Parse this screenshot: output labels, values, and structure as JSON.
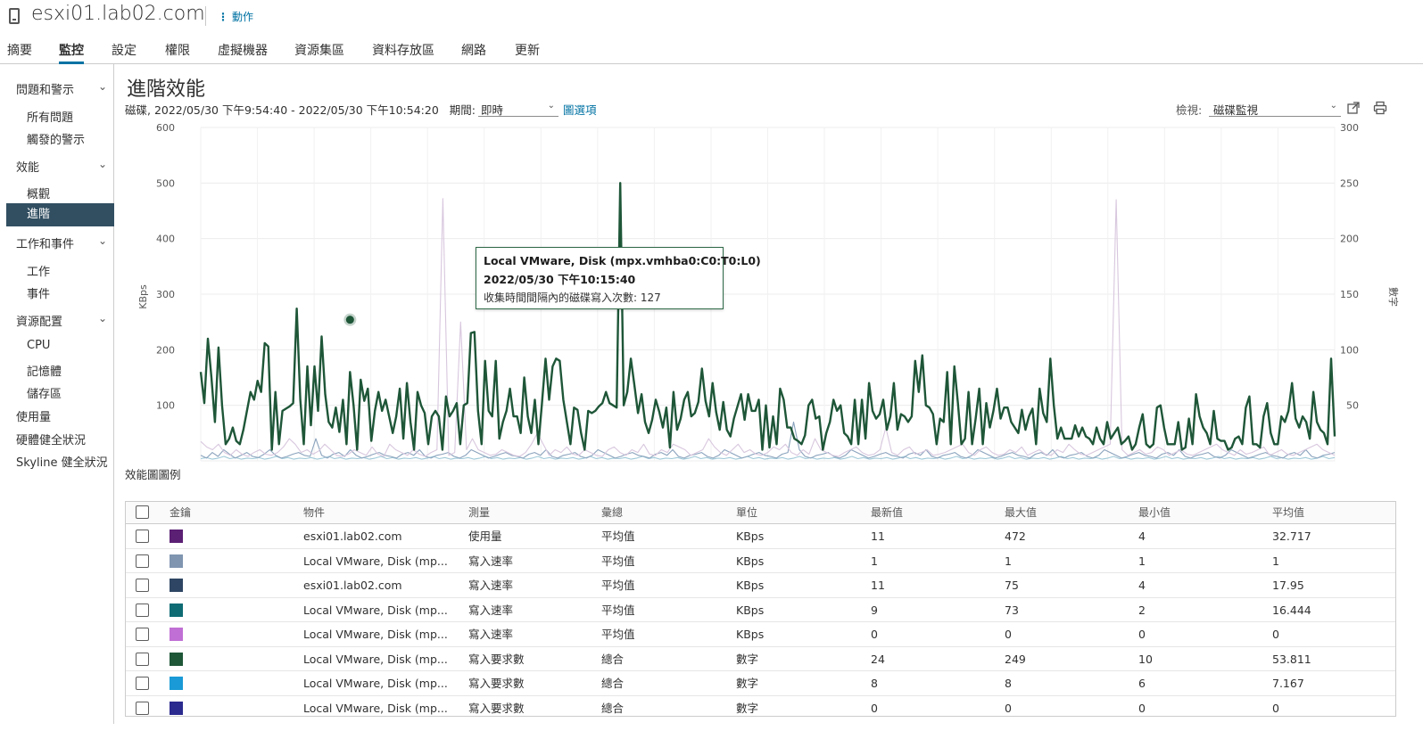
{
  "header": {
    "title": "esxi01.lab02.com",
    "actions_label": "動作"
  },
  "tabs": [
    {
      "label": "摘要"
    },
    {
      "label": "監控"
    },
    {
      "label": "設定"
    },
    {
      "label": "權限"
    },
    {
      "label": "虛擬機器"
    },
    {
      "label": "資源集區"
    },
    {
      "label": "資料存放區"
    },
    {
      "label": "網路"
    },
    {
      "label": "更新"
    }
  ],
  "active_tab": "監控",
  "sidebar": {
    "groups": [
      {
        "label": "問題和警示",
        "items": [
          "所有問題",
          "觸發的警示"
        ]
      },
      {
        "label": "效能",
        "items": [
          "概觀",
          "進階"
        ]
      },
      {
        "label": "工作和事件",
        "items": [
          "工作",
          "事件"
        ]
      },
      {
        "label": "資源配置",
        "items": [
          "CPU",
          "記憶體",
          "儲存區"
        ]
      }
    ],
    "top_items": [
      "使用量",
      "硬體健全狀況",
      "Skyline 健全狀況"
    ],
    "active_item": "進階"
  },
  "main": {
    "title": "進階效能",
    "subtitle": "磁碟, 2022/05/30 下午9:54:40 - 2022/05/30 下午10:54:20",
    "period_label": "期間:",
    "period_value": "即時",
    "chart_options_label": "圖選項",
    "view_label": "檢視:",
    "view_value": "磁碟監視",
    "legend_title": "效能圖圖例"
  },
  "tooltip": {
    "line1": "Local VMware, Disk (mpx.vmhba0:C0:T0:L0)",
    "line2": "2022/05/30 下午10:15:40",
    "line3": "收集時間間隔內的磁碟寫入次數: 127"
  },
  "chart_data": {
    "type": "line",
    "y_left": {
      "label": "KBps",
      "min": 0,
      "max": 600,
      "ticks": [
        "600",
        "500",
        "400",
        "300",
        "200",
        "100"
      ]
    },
    "y_right": {
      "label": "數字",
      "min": 0,
      "max": 300,
      "ticks": [
        "300",
        "250",
        "200",
        "150",
        "100",
        "50"
      ]
    },
    "grid": true,
    "highlight": {
      "series": "寫入要求數",
      "index": 42,
      "value": 127
    },
    "series": [
      {
        "name": "寫入要求數",
        "color": "#1e5638",
        "axis": "right",
        "width": 2.4,
        "values": [
          80,
          52,
          110,
          75,
          35,
          102,
          50,
          15,
          20,
          30,
          18,
          15,
          28,
          45,
          62,
          55,
          72,
          62,
          106,
          103,
          10,
          62,
          15,
          45,
          47,
          49,
          52,
          137,
          55,
          15,
          85,
          32,
          85,
          45,
          112,
          60,
          35,
          30,
          48,
          26,
          55,
          15,
          80,
          50,
          10,
          73,
          54,
          65,
          18,
          45,
          62,
          45,
          55,
          40,
          25,
          40,
          65,
          20,
          70,
          35,
          10,
          62,
          50,
          43,
          15,
          40,
          45,
          40,
          10,
          58,
          40,
          45,
          52,
          15,
          50,
          52,
          115,
          116,
          45,
          15,
          90,
          45,
          40,
          90,
          20,
          35,
          45,
          65,
          40,
          40,
          25,
          75,
          40,
          25,
          55,
          15,
          52,
          92,
          55,
          85,
          92,
          90,
          55,
          35,
          15,
          48,
          46,
          25,
          10,
          45,
          43,
          45,
          49,
          52,
          62,
          52,
          50,
          48,
          250,
          50,
          62,
          92,
          68,
          43,
          60,
          35,
          25,
          37,
          55,
          44,
          30,
          48,
          12,
          62,
          28,
          38,
          55,
          62,
          40,
          43,
          53,
          83,
          54,
          40,
          70,
          44,
          28,
          53,
          28,
          22,
          38,
          49,
          60,
          37,
          60,
          45,
          45,
          55,
          10,
          50,
          12,
          40,
          15,
          65,
          55,
          30,
          30,
          20,
          18,
          15,
          23,
          50,
          55,
          38,
          40,
          10,
          25,
          35,
          55,
          45,
          50,
          25,
          22,
          15,
          55,
          15,
          55,
          20,
          70,
          45,
          38,
          42,
          55,
          28,
          40,
          70,
          28,
          42,
          40,
          35,
          40,
          90,
          62,
          95,
          50,
          48,
          42,
          15,
          38,
          35,
          80,
          15,
          85,
          52,
          15,
          20,
          62,
          15,
          38,
          65,
          15,
          52,
          30,
          45,
          65,
          38,
          48,
          48,
          35,
          30,
          25,
          46,
          28,
          40,
          47,
          15,
          65,
          43,
          35,
          92,
          50,
          20,
          30,
          20,
          20,
          20,
          32,
          22,
          30,
          22,
          20,
          15,
          30,
          20,
          15,
          35,
          20,
          25,
          30,
          15,
          18,
          22,
          10,
          15,
          30,
          42,
          15,
          12,
          15,
          48,
          50,
          30,
          15,
          15,
          15,
          35,
          10,
          12,
          38,
          15,
          60,
          40,
          30,
          25,
          15,
          45,
          20,
          18,
          18,
          10,
          12,
          20,
          22,
          15,
          48,
          58,
          15,
          15,
          12,
          40,
          52,
          25,
          15,
          15,
          40,
          35,
          45,
          70,
          38,
          30,
          40,
          35,
          20,
          62,
          35,
          28,
          25,
          15,
          92,
          22
        ]
      },
      {
        "name": "使用量",
        "color": "#d8c7de",
        "axis": "left",
        "width": 1.1,
        "values": [
          35,
          25,
          20,
          30,
          15,
          10,
          20,
          12,
          8,
          15,
          20,
          12,
          10,
          15,
          25,
          40,
          30,
          15,
          20,
          12,
          18,
          30,
          20,
          10,
          8,
          12,
          20,
          15,
          10,
          25,
          12,
          8,
          30,
          20,
          15,
          10,
          20,
          12,
          8,
          15,
          20,
          472,
          10,
          15,
          250,
          20,
          40,
          20,
          15,
          10,
          12,
          20,
          15,
          10,
          8,
          15,
          30,
          50,
          30,
          10,
          20,
          15,
          25,
          12,
          10,
          20,
          15,
          10,
          8,
          20,
          25,
          15,
          10,
          20,
          15,
          30,
          12,
          10,
          20,
          15,
          30,
          25,
          20,
          10,
          15,
          20,
          40,
          25,
          15,
          10,
          20,
          30,
          15,
          20,
          12,
          10,
          15,
          25,
          20,
          30,
          15,
          10,
          20,
          12,
          40,
          20,
          15,
          10,
          8,
          15,
          20,
          25,
          15,
          10,
          12,
          20,
          60,
          15,
          10,
          20,
          25,
          12,
          15,
          20,
          10,
          12,
          15,
          20,
          25,
          30,
          15,
          10,
          20,
          25,
          15,
          10,
          12,
          20,
          15,
          25,
          10,
          15,
          20,
          12,
          10,
          20,
          15,
          30,
          20,
          12,
          10,
          15,
          20,
          25,
          30,
          470,
          20,
          10,
          15,
          20,
          12,
          15,
          25,
          20,
          10,
          15,
          20,
          12,
          10,
          15,
          20,
          25,
          30,
          20,
          15,
          10,
          20,
          12,
          15,
          20,
          25,
          10,
          15,
          20,
          12,
          10,
          15,
          20,
          25,
          30,
          20,
          15,
          10
        ]
      },
      {
        "name": "寫入速率",
        "color": "#8ba3bd",
        "axis": "left",
        "width": 1.1,
        "values": [
          10,
          5,
          15,
          8,
          20,
          12,
          5,
          10,
          15,
          8,
          6,
          12,
          20,
          10,
          5,
          8,
          12,
          15,
          10,
          8,
          40,
          10,
          5,
          12,
          15,
          8,
          20,
          10,
          5,
          8,
          12,
          15,
          10,
          8,
          5,
          12,
          15,
          10,
          20,
          8,
          5,
          10,
          12,
          15,
          8,
          5,
          10,
          20,
          15,
          10,
          5,
          8,
          12,
          15,
          10,
          8,
          5,
          12,
          15,
          10,
          20,
          8,
          5,
          10,
          12,
          15,
          8,
          5,
          10,
          20,
          15,
          10,
          5,
          8,
          12,
          15,
          10,
          8,
          5,
          12,
          15,
          10,
          20,
          8,
          5,
          10,
          12,
          15,
          8,
          5,
          10,
          20,
          15,
          10,
          5,
          8,
          12,
          15,
          10,
          8,
          5,
          12,
          15,
          70,
          20,
          8,
          5,
          10,
          12,
          15,
          8,
          5,
          10,
          20,
          15,
          10,
          5,
          8,
          12,
          15,
          10,
          8,
          5,
          12,
          15,
          10,
          20,
          8,
          5,
          10,
          12,
          15,
          8,
          5,
          10,
          20,
          15,
          10,
          5,
          8,
          12,
          15,
          10,
          8,
          5,
          12,
          15,
          10,
          20,
          8,
          5,
          10,
          12,
          15,
          8,
          5,
          10,
          20,
          15,
          10,
          5,
          8,
          12,
          15,
          10,
          8,
          5,
          12,
          15,
          10,
          20,
          8,
          5,
          10,
          12,
          15,
          8,
          5,
          10,
          20,
          15,
          10,
          5,
          8,
          12,
          15,
          10,
          8,
          5,
          12,
          15,
          10,
          20,
          8,
          5,
          10,
          12,
          15
        ]
      },
      {
        "name": "寫入速率",
        "color": "#9fc9d8",
        "axis": "left",
        "width": 1.1,
        "values": [
          4,
          6,
          3,
          5,
          8,
          4,
          6,
          3,
          5,
          4,
          6,
          3,
          5,
          8,
          4,
          6,
          3,
          5,
          4,
          6,
          3,
          5,
          8,
          4,
          6,
          3,
          5,
          4,
          6,
          3,
          5,
          8,
          4,
          6,
          3,
          5,
          4,
          6,
          3,
          5,
          8,
          4,
          6,
          3,
          5,
          4,
          6,
          3,
          5,
          8,
          4,
          6,
          3,
          5,
          4,
          6,
          3,
          5,
          8,
          4,
          6,
          3,
          5,
          4,
          6,
          3,
          5,
          8,
          4,
          6,
          3,
          5,
          4,
          6,
          3,
          5,
          8,
          4,
          6,
          3,
          5,
          4,
          6,
          3,
          5,
          8,
          4,
          6,
          3,
          5,
          4,
          6,
          3,
          5,
          8,
          4,
          6,
          3,
          5,
          4,
          6,
          3,
          5,
          8,
          4,
          6,
          3,
          5,
          4,
          6,
          3,
          5,
          8,
          4,
          6,
          3,
          5,
          4,
          6,
          3,
          5,
          8,
          4,
          6,
          3,
          5,
          4,
          6,
          3,
          5,
          8,
          4,
          6,
          3,
          5,
          4,
          6,
          3,
          5,
          8,
          4,
          6,
          3,
          5,
          4,
          6,
          3,
          5,
          8,
          4,
          6,
          3,
          5,
          4,
          6,
          3,
          5,
          8,
          4,
          6,
          3,
          5,
          4,
          6,
          3,
          5,
          8,
          4,
          6,
          3,
          5,
          4,
          6,
          3,
          5,
          8,
          4,
          6,
          3,
          5,
          4,
          6,
          3,
          5,
          8,
          4,
          6,
          3,
          5,
          4,
          6,
          3,
          5,
          8,
          4,
          6
        ]
      }
    ]
  },
  "table": {
    "columns": [
      "金鑰",
      "物件",
      "測量",
      "彙總",
      "單位",
      "最新值",
      "最大值",
      "最小值",
      "平均值"
    ],
    "rows": [
      {
        "color": "#5b1f74",
        "object": "esxi01.lab02.com",
        "measure": "使用量",
        "rollup": "平均值",
        "unit": "KBps",
        "latest": "11",
        "max": "472",
        "min": "4",
        "avg": "32.717"
      },
      {
        "color": "#7f95b0",
        "object": "Local VMware, Disk (mp...",
        "measure": "寫入速率",
        "rollup": "平均值",
        "unit": "KBps",
        "latest": "1",
        "max": "1",
        "min": "1",
        "avg": "1"
      },
      {
        "color": "#2e4663",
        "object": "esxi01.lab02.com",
        "measure": "寫入速率",
        "rollup": "平均值",
        "unit": "KBps",
        "latest": "11",
        "max": "75",
        "min": "4",
        "avg": "17.95"
      },
      {
        "color": "#0e6b74",
        "object": "Local VMware, Disk (mp...",
        "measure": "寫入速率",
        "rollup": "平均值",
        "unit": "KBps",
        "latest": "9",
        "max": "73",
        "min": "2",
        "avg": "16.444"
      },
      {
        "color": "#c06fd4",
        "object": "Local VMware, Disk (mp...",
        "measure": "寫入速率",
        "rollup": "平均值",
        "unit": "KBps",
        "latest": "0",
        "max": "0",
        "min": "0",
        "avg": "0"
      },
      {
        "color": "#1e5638",
        "object": "Local VMware, Disk (mp...",
        "measure": "寫入要求數",
        "rollup": "總合",
        "unit": "數字",
        "latest": "24",
        "max": "249",
        "min": "10",
        "avg": "53.811"
      },
      {
        "color": "#1a9ad6",
        "object": "Local VMware, Disk (mp...",
        "measure": "寫入要求數",
        "rollup": "總合",
        "unit": "數字",
        "latest": "8",
        "max": "8",
        "min": "6",
        "avg": "7.167"
      },
      {
        "color": "#2b2a8e",
        "object": "Local VMware, Disk (mp...",
        "measure": "寫入要求數",
        "rollup": "總合",
        "unit": "數字",
        "latest": "0",
        "max": "0",
        "min": "0",
        "avg": "0"
      }
    ]
  }
}
